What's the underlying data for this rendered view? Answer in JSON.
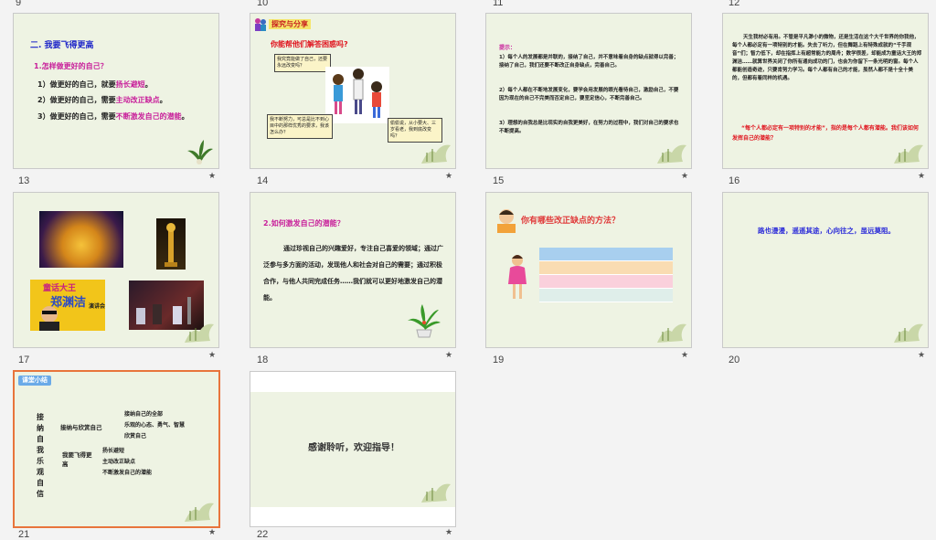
{
  "slide_numbers": [
    "9",
    "10",
    "11",
    "12",
    "13",
    "14",
    "15",
    "16",
    "17",
    "18",
    "19",
    "20",
    "21",
    "22"
  ],
  "star": "★",
  "s9": {
    "title": "二. 我要飞得更高",
    "q": "1.怎样做更好的自己？",
    "l1a": "1）做更好的自己，就要",
    "l1b": "扬长避短",
    "l1c": "。",
    "l2a": "2）做更好的自己，需要",
    "l2b": "主动改正缺点",
    "l2c": "。",
    "l3a": "3）做更好的自己，需要",
    "l3b": "不断激发自己的潜能",
    "l3c": "。"
  },
  "s10": {
    "badge": "探究与分享",
    "q": "你能帮他们解答困惑吗?",
    "b1": "我究竟能做了自己，还要永远改变吗？",
    "b2": "我不断努力，可总是比不到心目中的那样优秀的要求，我该怎么办？",
    "b3": "偷偷说，从小要大、三岁看老，我到底改变吗？"
  },
  "s11": {
    "tip": "提示：",
    "p1": "1）每个人的发展都是并联的，接纳了自己，并不意味着自身的缺点就得以完善；接纳了自己，我们还要不断改正自身缺点，完善自己。",
    "p2": "2）每个人都在不断地发展变化，要学会用发展的眼光看待自己，激励自己，不要因为现在的自己不完美而否定自己，要坚定信心，不断完善自己。",
    "p3": "3）理想的自我总是比现实的自我更美好，在努力的过程中，我们对自己的要求也不断提高。"
  },
  "s12": {
    "p1": "天生我材必有用。不管是平凡渺小的微物，还是生活在这个大千世界的你我他，每个人都必定有一项特别的才能。失去了听力，但在舞蹈上有特殊成就的“千手观音”们；智力低下，却在指挥上有超常能力的周舟；数学很差，却能成为童话大王的郑渊洁……就算世界关闭了你所有通向成功的门，也会为你留下一条光明的窗。每个人都能创造奇迹，只要肯努力学习。每个人都有自己的才能，虽然人都不是十全十美的，但都有着同样的机遇。",
    "quote": "“每个人都必定有一项特别的才能”，指的是每个人都有潜能。我们该如何发挥自己的潜能？"
  },
  "s13": {
    "photo3_line1": "童话大王",
    "photo3_line2": "郑渊洁",
    "photo3_side": "演讲会"
  },
  "s14": {
    "title": "2.如何激发自己的潜能？",
    "body": "通过珍视自己的兴趣爱好，专注自己喜爱的领域；通过广泛参与多方面的活动，发现他人和社会对自己的需要；通过积极合作，与他人共同完成任务……我们就可以更好地激发自己的潜能。"
  },
  "s15": {
    "title": "你有哪些改正缺点的方法？",
    "rows": [
      "",
      "",
      "",
      ""
    ],
    "row_colors": [
      "#a8cfef",
      "#f9dcb2",
      "#fad0dc",
      "#dfeeea"
    ]
  },
  "s16": {
    "text": "路也漫漫，遥遥其途，心向往之，虽远莫阻。"
  },
  "s17": {
    "badge": "课堂小结",
    "vertical": "接纳自我乐观自信",
    "b1": "接纳与欣赏自己",
    "b1_items": [
      "接纳自己的全部",
      "乐观的心态、勇气、智慧",
      "欣赏自己"
    ],
    "b2": "我要飞得更高",
    "b2_items": [
      "扬长避短",
      "主动改正缺点",
      "不断激发自己的潜能"
    ]
  },
  "s18": {
    "text": "感谢聆听，欢迎指导！"
  },
  "colors": {
    "slide_bg": "#eef3e3",
    "accent_orange": "#e8743b",
    "title_blue": "#1a22c8",
    "magenta": "#c81e9a",
    "red": "#e0141e"
  }
}
